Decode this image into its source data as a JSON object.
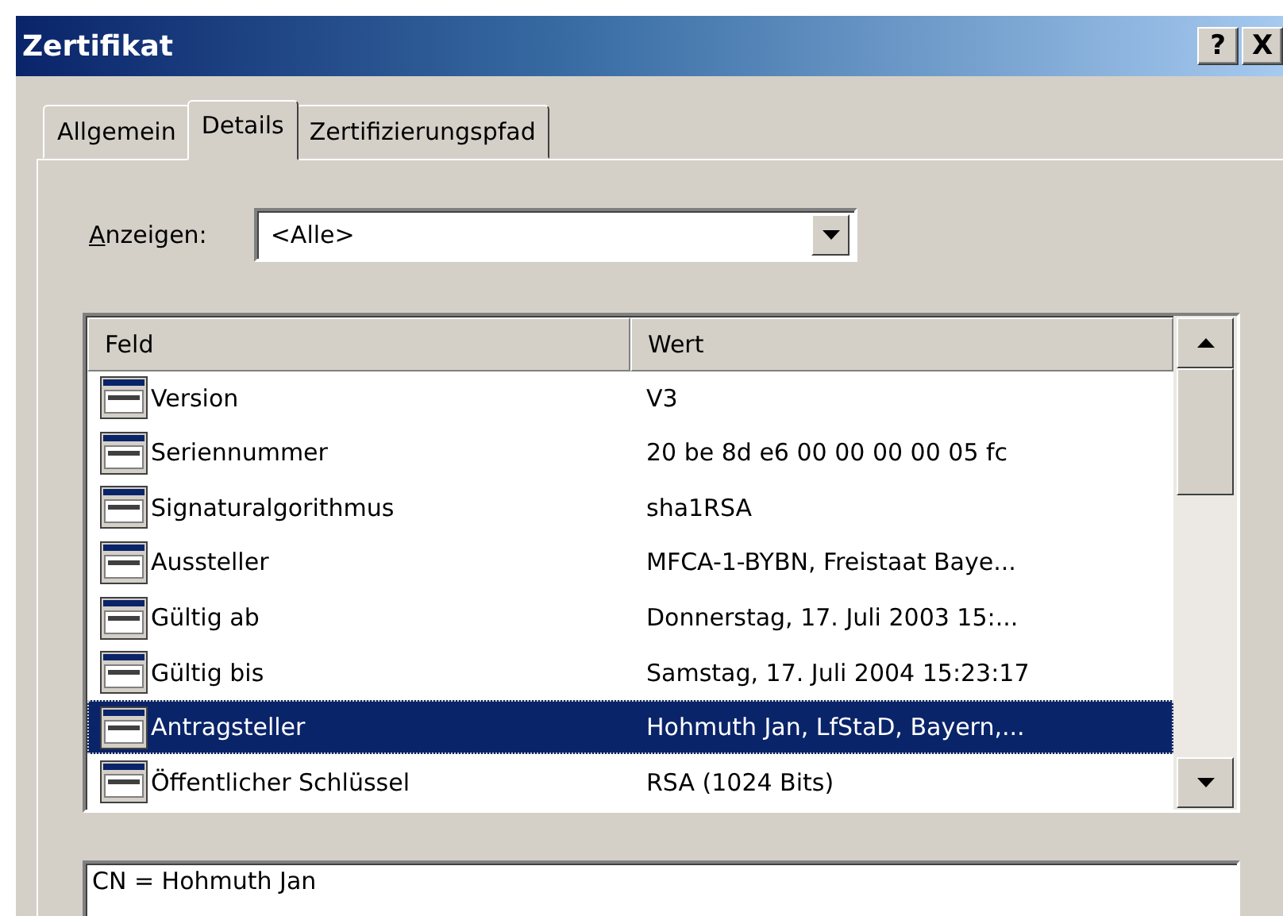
{
  "window": {
    "title": "Zertifikat",
    "buttons": [
      "?",
      "X"
    ]
  },
  "tabs": [
    {
      "label": "Allgemein",
      "selected": false
    },
    {
      "label": "Details",
      "selected": true
    },
    {
      "label": "Zertifizierungspfad",
      "selected": false
    }
  ],
  "show": {
    "label": "Anzeigen:",
    "value": "<Alle>"
  },
  "table": {
    "columns": [
      "Feld",
      "Wert"
    ],
    "rows": [
      {
        "field": "Version",
        "value": "V3",
        "selected": false
      },
      {
        "field": "Seriennummer",
        "value": "20 be 8d e6 00 00 00 00 05 fc",
        "selected": false
      },
      {
        "field": "Signaturalgorithmus",
        "value": "sha1RSA",
        "selected": false
      },
      {
        "field": "Aussteller",
        "value": "MFCA-1-BYBN, Freistaat Baye...",
        "selected": false
      },
      {
        "field": "Gültig ab",
        "value": "Donnerstag, 17. Juli 2003 15:...",
        "selected": false
      },
      {
        "field": "Gültig bis",
        "value": "Samstag, 17. Juli 2004 15:23:17",
        "selected": false
      },
      {
        "field": "Antragsteller",
        "value": "Hohmuth Jan, LfStaD, Bayern,...",
        "selected": true
      },
      {
        "field": "Öffentlicher Schlüssel",
        "value": "RSA (1024 Bits)",
        "selected": false
      }
    ]
  },
  "detail": {
    "value": "CN = Hohmuth Jan"
  }
}
